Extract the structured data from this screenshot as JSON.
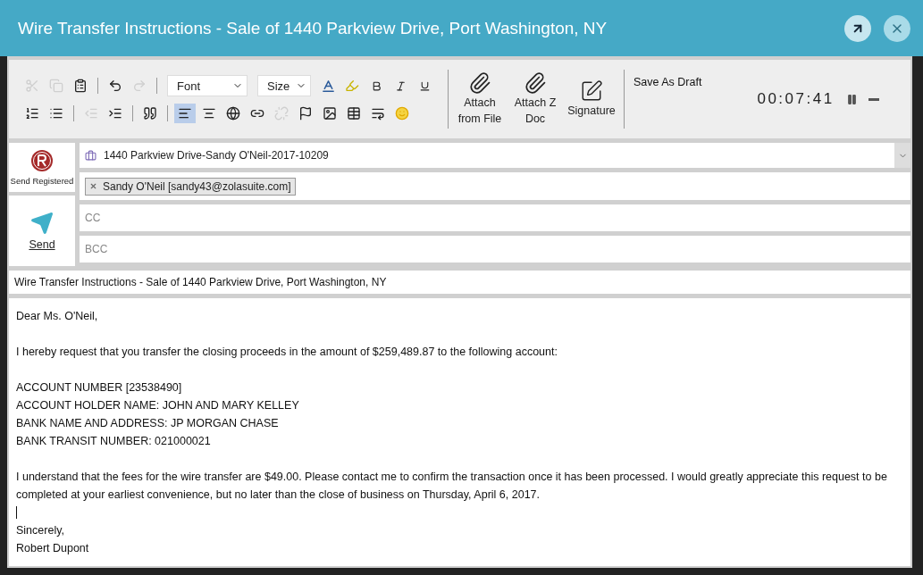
{
  "window": {
    "title": "Wire Transfer Instructions - Sale of 1440 Parkview Drive, Port Washington, NY"
  },
  "toolbar": {
    "font": "Font",
    "size": "Size",
    "edit_buttons": [
      {
        "kind": "cut",
        "disabled": true
      },
      {
        "kind": "copy",
        "disabled": true
      },
      {
        "kind": "paste",
        "disabled": false
      },
      {
        "kind": "undo",
        "disabled": false
      },
      {
        "kind": "redo",
        "disabled": true
      }
    ],
    "format_buttons": [
      {
        "kind": "numbered-list",
        "disabled": false,
        "selected": false
      },
      {
        "kind": "bullet-list",
        "disabled": false,
        "selected": false
      },
      {
        "kind": "outdent",
        "disabled": true,
        "selected": false
      },
      {
        "kind": "indent",
        "disabled": false,
        "selected": false
      },
      {
        "kind": "quote",
        "disabled": false,
        "selected": false
      },
      {
        "kind": "align-left",
        "disabled": false,
        "selected": true
      },
      {
        "kind": "align-center",
        "disabled": false,
        "selected": false
      },
      {
        "kind": "language",
        "disabled": false,
        "selected": false
      },
      {
        "kind": "link",
        "disabled": false,
        "selected": false
      },
      {
        "kind": "unlink",
        "disabled": true,
        "selected": false
      },
      {
        "kind": "flag",
        "disabled": false,
        "selected": false
      },
      {
        "kind": "image",
        "disabled": false,
        "selected": false
      },
      {
        "kind": "table",
        "disabled": false,
        "selected": false
      },
      {
        "kind": "spellcheck",
        "disabled": false,
        "selected": false
      },
      {
        "kind": "emoji",
        "disabled": false,
        "selected": false
      }
    ],
    "attachments": [
      {
        "kind": "clip",
        "label": "Attach from File"
      },
      {
        "kind": "clip",
        "label": "Attach Z Doc"
      },
      {
        "kind": "signature",
        "label": "Signature"
      }
    ],
    "save_draft": "Save As Draft",
    "timer": "00:07:41"
  },
  "actions": [
    {
      "kind": "registered",
      "label": "Send Registered"
    },
    {
      "kind": "send",
      "label": "Send"
    }
  ],
  "matter": "1440 Parkview Drive-Sandy O'Neil-2017-10209",
  "recipients": [
    "Sandy O'Neil [sandy43@zolasuite.com]"
  ],
  "cc": {
    "placeholder": "CC"
  },
  "bcc": {
    "placeholder": "BCC"
  },
  "subject": "Wire Transfer Instructions - Sale of 1440 Parkview Drive, Port Washington, NY",
  "body": {
    "paragraphs": [
      {
        "kind": "text",
        "lines": [
          "Dear Ms. O'Neil,"
        ]
      },
      {
        "kind": "text",
        "lines": [
          "I hereby request that you transfer the closing proceeds in the amount of $259,489.87 to the following account:"
        ]
      },
      {
        "kind": "text",
        "lines": [
          "ACCOUNT NUMBER [23538490]",
          "ACCOUNT HOLDER NAME: JOHN AND MARY KELLEY",
          "BANK NAME AND ADDRESS: JP MORGAN CHASE",
          "BANK TRANSIT NUMBER: 021000021"
        ]
      },
      {
        "kind": "text",
        "lines": [
          "I understand that the fees for the wire transfer are $49.00. Please contact me to confirm the transaction once it has been processed. I would greatly appreciate this request to be completed at your earliest convenience, but no later than the close of business on Thursday, April 6, 2017."
        ]
      },
      {
        "kind": "caret"
      },
      {
        "kind": "text",
        "lines": [
          "Sincerely,",
          "Robert Dupont"
        ]
      }
    ]
  }
}
